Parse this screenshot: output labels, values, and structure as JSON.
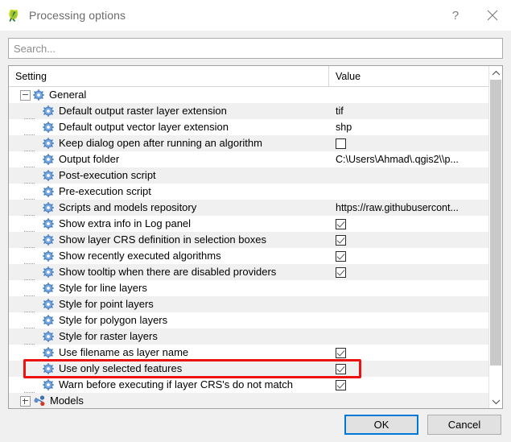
{
  "window": {
    "title": "Processing options",
    "app_icon": "qgis-icon",
    "help_label": "?",
    "close_label": "×"
  },
  "search": {
    "value": "",
    "placeholder": "Search..."
  },
  "tree": {
    "columns": {
      "setting": "Setting",
      "value": "Value"
    },
    "groups": [
      {
        "label": "General",
        "icon": "gear-icon",
        "expanded": true,
        "expander": "minus"
      },
      {
        "label": "Models",
        "icon": "models-icon",
        "expanded": false,
        "expander": "plus"
      }
    ],
    "rows": [
      {
        "label": "Default output raster layer extension",
        "value": "tif",
        "type": "text"
      },
      {
        "label": "Default output vector layer extension",
        "value": "shp",
        "type": "text"
      },
      {
        "label": "Keep dialog open after running an algorithm",
        "value": "unchecked",
        "type": "checkbox"
      },
      {
        "label": "Output folder",
        "value": "C:\\Users\\Ahmad\\.qgis2\\\\p...",
        "type": "text"
      },
      {
        "label": "Post-execution script",
        "value": "",
        "type": "text"
      },
      {
        "label": "Pre-execution script",
        "value": "",
        "type": "text"
      },
      {
        "label": "Scripts and models repository",
        "value": "https://raw.githubusercont...",
        "type": "text"
      },
      {
        "label": "Show extra info in Log panel",
        "value": "checked",
        "type": "checkbox"
      },
      {
        "label": "Show layer CRS definition in selection boxes",
        "value": "checked",
        "type": "checkbox"
      },
      {
        "label": "Show recently executed algorithms",
        "value": "checked",
        "type": "checkbox"
      },
      {
        "label": "Show tooltip when there are disabled providers",
        "value": "checked",
        "type": "checkbox"
      },
      {
        "label": "Style for line layers",
        "value": "",
        "type": "text"
      },
      {
        "label": "Style for point layers",
        "value": "",
        "type": "text"
      },
      {
        "label": "Style for polygon layers",
        "value": "",
        "type": "text"
      },
      {
        "label": "Style for raster layers",
        "value": "",
        "type": "text"
      },
      {
        "label": "Use filename as layer name",
        "value": "checked",
        "type": "checkbox"
      },
      {
        "label": "Use only selected features",
        "value": "checked",
        "type": "checkbox",
        "highlighted": true
      },
      {
        "label": "Warn before executing if layer CRS's do not match",
        "value": "checked",
        "type": "checkbox"
      }
    ]
  },
  "scrollbar": {
    "up_arrow": "chevron-up-icon",
    "down_arrow": "chevron-down-icon"
  },
  "footer": {
    "ok_label": "OK",
    "cancel_label": "Cancel"
  },
  "colors": {
    "highlight": "#ee1111",
    "focus_border": "#0078d7",
    "row_alt": "#f0f0f0",
    "dialog_bg": "#f0f0f0"
  }
}
